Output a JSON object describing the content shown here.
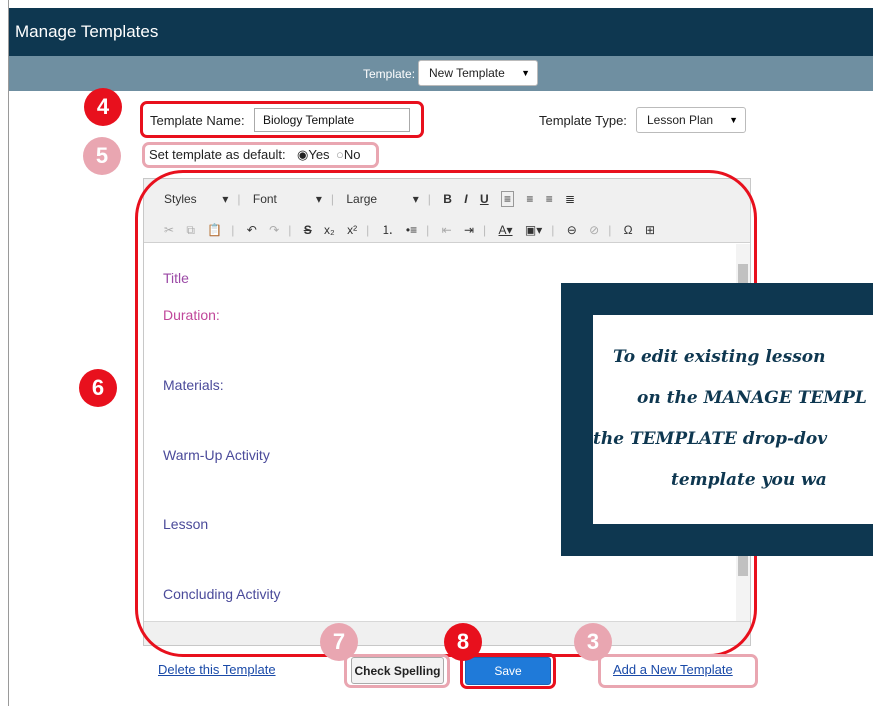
{
  "window": {
    "title": "Manage Templates"
  },
  "template_bar": {
    "label": "Template:",
    "selected": "New Template"
  },
  "form": {
    "name_label": "Template Name:",
    "name_value": "Biology Template",
    "type_label": "Template Type:",
    "type_value": "Lesson Plan",
    "default_label": "Set template as default:",
    "yes_label": "Yes",
    "no_label": "No",
    "default_selected": "Yes"
  },
  "editor": {
    "styles_label": "Styles",
    "font_label": "Font",
    "size_label": "Large",
    "sections": [
      "Title",
      "Duration:",
      "Materials:",
      "Warm-Up Activity",
      "Lesson",
      "Concluding Activity"
    ]
  },
  "actions": {
    "delete_label": "Delete this Template",
    "spell_label": "Check Spelling",
    "save_label": "Save",
    "add_label": "Add a New Template"
  },
  "annotations": {
    "badge_4": "4",
    "badge_5": "5",
    "badge_6": "6",
    "badge_7": "7",
    "badge_8": "8",
    "badge_3": "3"
  },
  "callout": {
    "line1": "To edit existing lesson",
    "line2": "on the MANAGE TEMPL",
    "line3": "the TEMPLATE drop-dov",
    "line4": "template you wa"
  },
  "colors": {
    "header": "#0e3750",
    "strip": "#6f8fa1",
    "highlight_red": "#e8101d",
    "highlight_pink": "#e9a6b1",
    "save_blue": "#1f7ad9",
    "link": "#1a4aa8"
  }
}
